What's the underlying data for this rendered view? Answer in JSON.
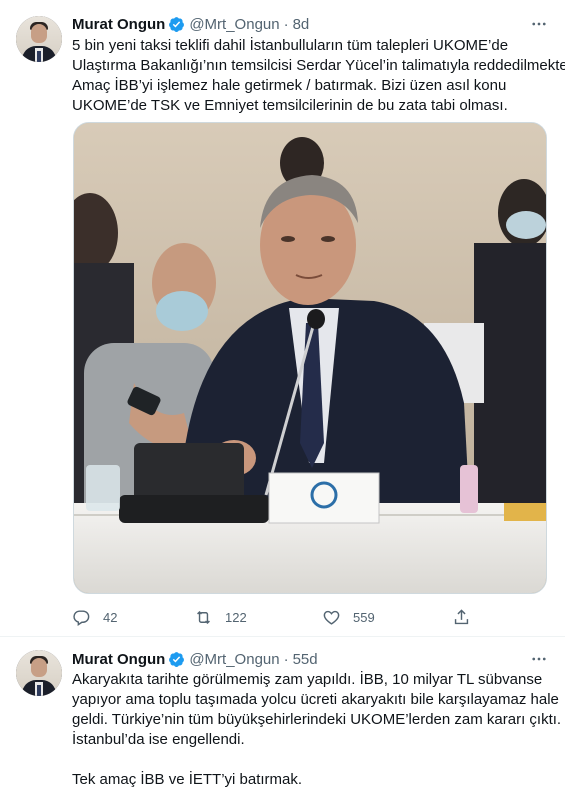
{
  "tweets": [
    {
      "name": "Murat Ongun",
      "handle": "@Mrt_Ongun",
      "separator": "·",
      "time": "8d",
      "lines": [
        "5 bin yeni taksi teklifi dahil İstanbulluların tüm talepleri UKOME’de",
        "Ulaştırma Bakanlığı’nın temsilcisi Serdar Yücel’in talimatıyla reddedilmekte.",
        "Amaç İBB’yi işlemez hale getirmek / batırmak. Bizi üzen asıl konu",
        "UKOME’de TSK ve Emniyet temsilcilerinin de bu zata tabi olması."
      ],
      "replies": "42",
      "retweets": "122",
      "likes": "559"
    },
    {
      "name": "Murat Ongun",
      "handle": "@Mrt_Ongun",
      "separator": "·",
      "time": "55d",
      "lines": [
        "Akaryakıta tarihte görülmemiş zam yapıldı. İBB, 10 milyar TL sübvanse",
        "yapıyor ama toplu taşımada yolcu ücreti akaryakıtı bile karşılayamaz hale",
        "geldi. Türkiye’nin tüm büyükşehirlerindeki UKOME’lerden zam kararı çıktı.",
        "İstanbul’da ise engellendi.",
        "",
        "Tek amaç İBB ve İETT’yi batırmak."
      ]
    }
  ],
  "colors": {
    "verified": "#1d9bf0",
    "secondary_text": "#536471",
    "border": "#cfd9de"
  },
  "icons": [
    "verified-badge-icon",
    "more-options-icon",
    "reply-icon",
    "retweet-icon",
    "like-icon",
    "share-icon"
  ]
}
